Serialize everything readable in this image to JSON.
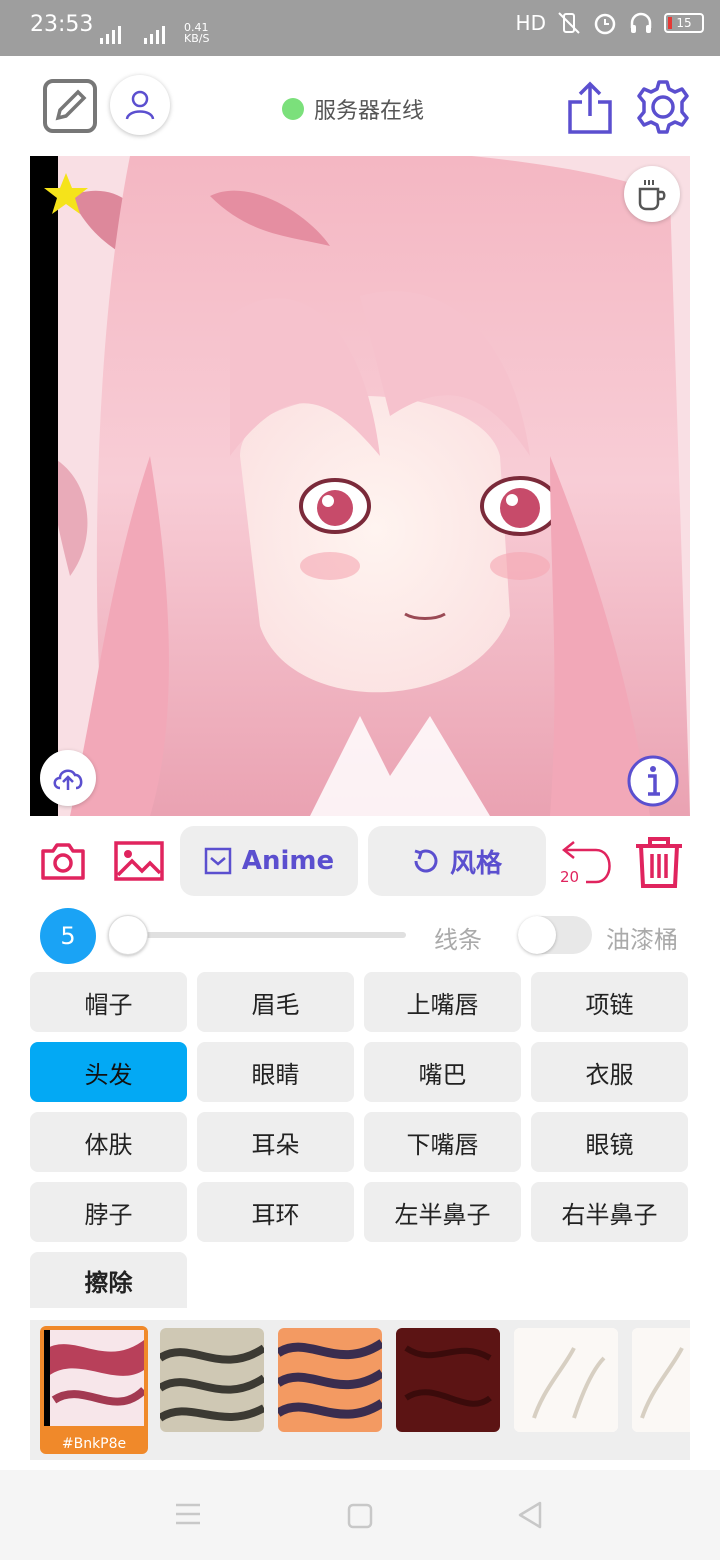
{
  "status_bar": {
    "time": "23:53",
    "net_speed_value": "0.41",
    "net_speed_unit": "KB/S",
    "hd_label": "HD",
    "battery_level": "15",
    "color": "#9e9e9e"
  },
  "header": {
    "server_status": "服务器在线",
    "server_status_color": "#7be07b",
    "accent_color": "#5b4fcf"
  },
  "canvas": {
    "favorite_icon": "star-icon",
    "coffee_icon": "coffee-cup-icon",
    "upload_icon": "cloud-upload-icon",
    "info_icon": "info-icon"
  },
  "toolbar": {
    "anime_label": "Anime",
    "style_label": "风格",
    "undo_count": "20",
    "tool_color": "#e0245e"
  },
  "brush": {
    "size": "5",
    "line_label": "线条",
    "bucket_label": "油漆桶",
    "line_level": 0,
    "bucket_enabled": false
  },
  "parts": [
    "帽子",
    "眉毛",
    "上嘴唇",
    "项链",
    "头发",
    "眼睛",
    "嘴巴",
    "衣服",
    "体肤",
    "耳朵",
    "下嘴唇",
    "眼镜",
    "脖子",
    "耳环",
    "左半鼻子",
    "右半鼻子",
    "擦除"
  ],
  "selected_part": "头发",
  "selected_color": "#03a9f4",
  "swatches": {
    "selected_label": "#BnkP8e"
  }
}
